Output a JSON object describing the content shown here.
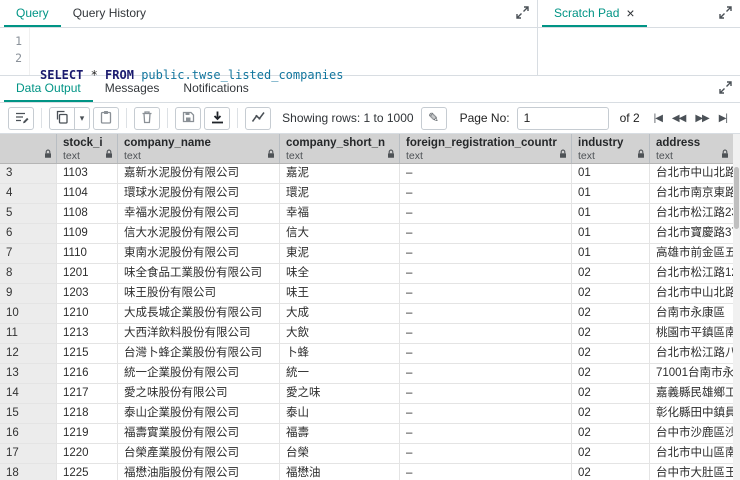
{
  "colors": {
    "accent": "#009485"
  },
  "query_panel": {
    "tabs": [
      {
        "label": "Query"
      },
      {
        "label": "Query History"
      }
    ]
  },
  "scratch_pad": {
    "title": "Scratch Pad",
    "close": "×"
  },
  "editor": {
    "line_numbers": [
      "1",
      "2"
    ],
    "sql_tokens": [
      {
        "text": "SELECT",
        "cls": "kw"
      },
      {
        "text": " * ",
        "cls": ""
      },
      {
        "text": "FROM",
        "cls": "kw"
      },
      {
        "text": " ",
        "cls": ""
      },
      {
        "text": "public.twse_listed_companies",
        "cls": "ident"
      }
    ]
  },
  "output_tabs": [
    {
      "label": "Data Output"
    },
    {
      "label": "Messages"
    },
    {
      "label": "Notifications"
    }
  ],
  "toolbar": {
    "showing_rows": "Showing rows: 1 to 1000",
    "edit_icon": "✎",
    "dropdown_caret": "▾",
    "page_no_label": "Page No:",
    "page_value": "1",
    "of_label": "of 2",
    "pagination": {
      "first": "|◀",
      "prev": "◀◀",
      "next": "▶▶",
      "last": "▶|"
    }
  },
  "grid": {
    "columns": [
      {
        "name": "stock_id",
        "type": "text"
      },
      {
        "name": "company_name",
        "type": "text"
      },
      {
        "name": "company_short_name",
        "type": "text"
      },
      {
        "name": "foreign_registration_country",
        "type": "text"
      },
      {
        "name": "industry",
        "type": "text"
      },
      {
        "name": "address",
        "type": "text"
      }
    ],
    "rows": [
      [
        "3",
        "1103",
        "嘉新水泥股份有限公司",
        "嘉泥",
        "–",
        "01",
        "台北市中山北路"
      ],
      [
        "4",
        "1104",
        "環球水泥股份有限公司",
        "環泥",
        "–",
        "01",
        "台北市南京東路"
      ],
      [
        "5",
        "1108",
        "幸福水泥股份有限公司",
        "幸福",
        "–",
        "01",
        "台北市松江路23"
      ],
      [
        "6",
        "1109",
        "信大水泥股份有限公司",
        "信大",
        "–",
        "01",
        "台北市寶慶路37"
      ],
      [
        "7",
        "1110",
        "東南水泥股份有限公司",
        "東泥",
        "–",
        "01",
        "高雄市前金區五"
      ],
      [
        "8",
        "1201",
        "味全食品工業股份有限公司",
        "味全",
        "–",
        "02",
        "台北市松江路12"
      ],
      [
        "9",
        "1203",
        "味王股份有限公司",
        "味王",
        "–",
        "02",
        "台北市中山北路"
      ],
      [
        "10",
        "1210",
        "大成長城企業股份有限公司",
        "大成",
        "–",
        "02",
        "台南市永康區"
      ],
      [
        "11",
        "1213",
        "大西洋飲料股份有限公司",
        "大飲",
        "–",
        "02",
        "桃園市平鎮區南"
      ],
      [
        "12",
        "1215",
        "台灣卜蜂企業股份有限公司",
        "卜蜂",
        "–",
        "02",
        "台北市松江路八"
      ],
      [
        "13",
        "1216",
        "統一企業股份有限公司",
        "統一",
        "–",
        "02",
        "71001台南市永"
      ],
      [
        "14",
        "1217",
        "愛之味股份有限公司",
        "愛之味",
        "–",
        "02",
        "嘉義縣民雄鄉工"
      ],
      [
        "15",
        "1218",
        "泰山企業股份有限公司",
        "泰山",
        "–",
        "02",
        "彰化縣田中鎮員"
      ],
      [
        "16",
        "1219",
        "福壽實業股份有限公司",
        "福壽",
        "–",
        "02",
        "台中市沙鹿區沙"
      ],
      [
        "17",
        "1220",
        "台榮產業股份有限公司",
        "台榮",
        "–",
        "02",
        "台北市中山區南"
      ],
      [
        "18",
        "1225",
        "福懋油脂股份有限公司",
        "福懋油",
        "–",
        "02",
        "台中市大肚區王"
      ]
    ]
  }
}
